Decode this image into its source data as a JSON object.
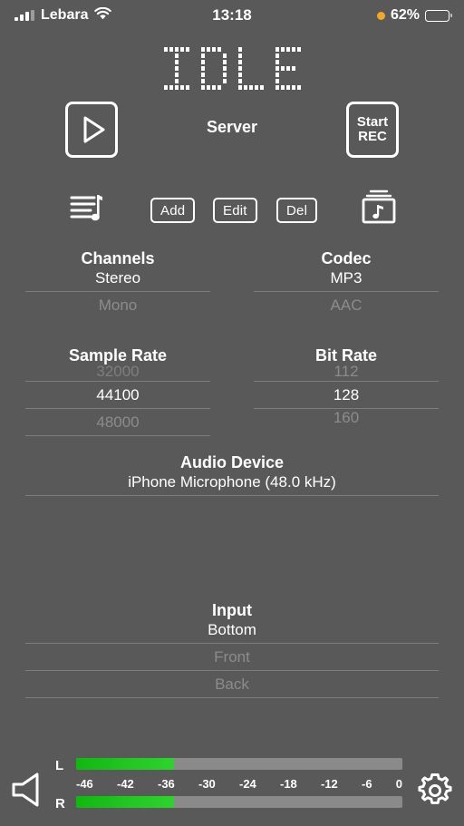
{
  "status_bar": {
    "carrier": "Lebara",
    "signal_icon": "signal-bars-icon",
    "wifi_icon": "wifi-icon",
    "time": "13:18",
    "low_power_icon": "low-power-dot-icon",
    "battery_percent": "62%",
    "battery_icon": "battery-icon",
    "battery_level": 62
  },
  "display": {
    "status_text": "IDLE",
    "chars": [
      "I",
      "D",
      "L",
      "E"
    ]
  },
  "transport": {
    "play_icon": "play-icon",
    "mode_label": "Server",
    "rec_line1": "Start",
    "rec_line2": "REC"
  },
  "toolbar": {
    "playlist_icon": "playlist-icon",
    "add_label": "Add",
    "edit_label": "Edit",
    "del_label": "Del",
    "library_icon": "music-library-icon"
  },
  "pickers": {
    "channels": {
      "title": "Channels",
      "selected": "Stereo",
      "options": [
        "Stereo",
        "Mono"
      ]
    },
    "codec": {
      "title": "Codec",
      "selected": "MP3",
      "options": [
        "MP3",
        "AAC"
      ]
    },
    "sample_rate": {
      "title": "Sample Rate",
      "selected": "44100",
      "hidden_above": "32000",
      "options": [
        "32000",
        "44100",
        "48000"
      ]
    },
    "bit_rate": {
      "title": "Bit Rate",
      "selected": "128",
      "options": [
        "112",
        "128",
        "160"
      ]
    },
    "audio_device": {
      "title": "Audio Device",
      "selected": "iPhone Microphone (48.0 kHz)",
      "options": [
        "iPhone Microphone (48.0 kHz)"
      ]
    },
    "input": {
      "title": "Input",
      "selected": "Bottom",
      "options": [
        "Bottom",
        "Front",
        "Back"
      ]
    }
  },
  "meters": {
    "speaker_icon": "speaker-icon",
    "gear_icon": "gear-icon",
    "left_label": "L",
    "right_label": "R",
    "left_level_percent": 30,
    "right_level_percent": 30,
    "scale_ticks": [
      "-46",
      "-42",
      "-36",
      "-30",
      "-24",
      "-18",
      "-12",
      "-6",
      "0"
    ],
    "fill_color": "#23c723",
    "track_color": "#8a8a8a"
  },
  "theme": {
    "background": "#595959",
    "foreground": "#ffffff",
    "dim": "rgba(255,255,255,0.30)"
  }
}
